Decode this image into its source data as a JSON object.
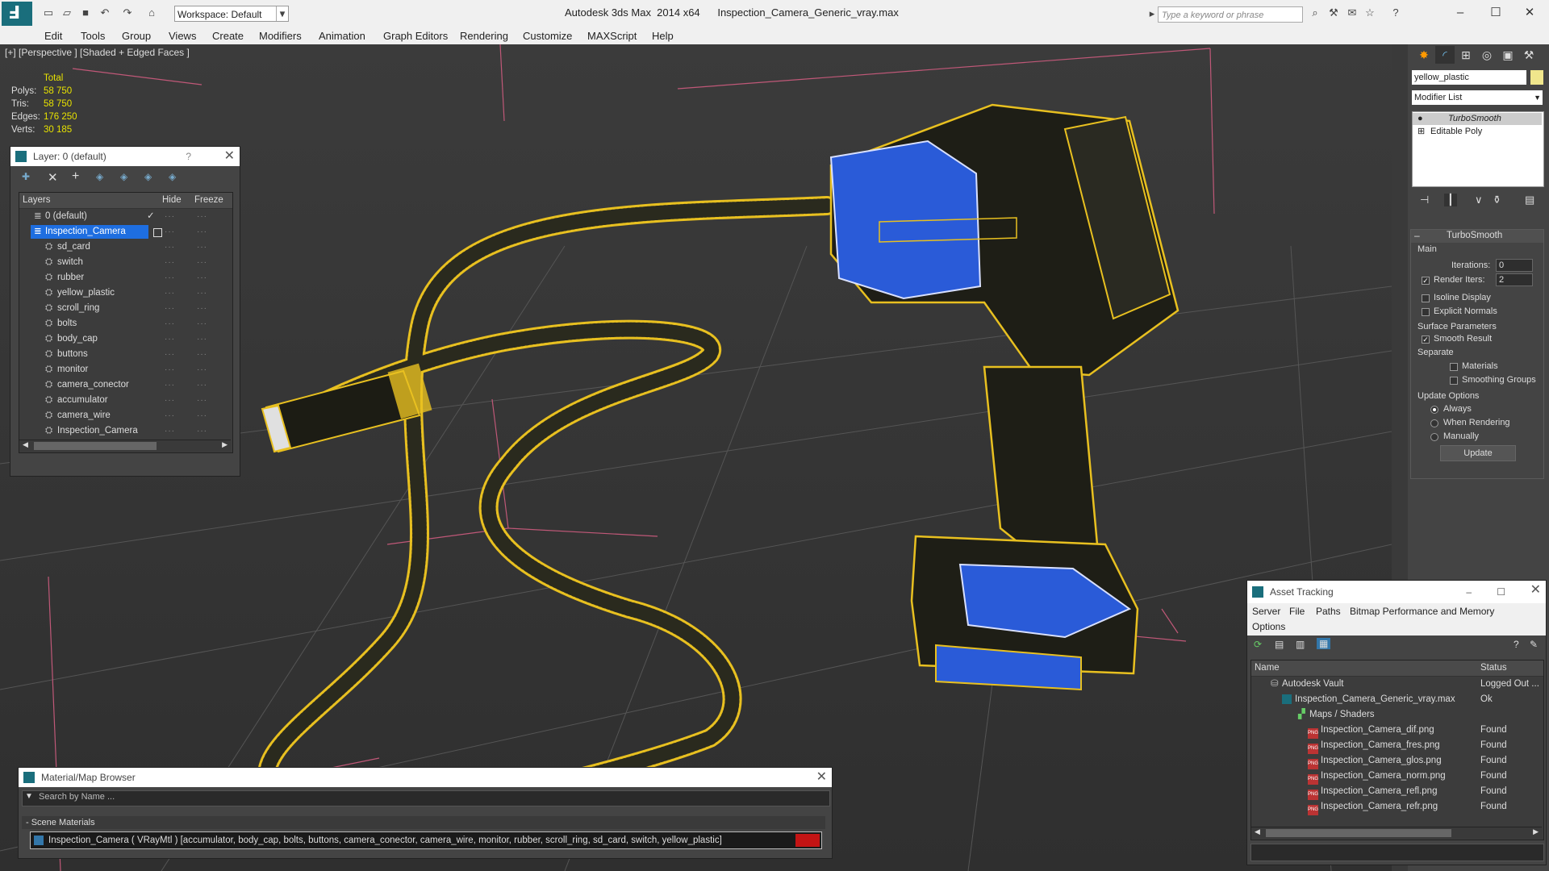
{
  "titlebar": {
    "workspace": "Workspace: Default",
    "app_name": "Autodesk 3ds Max  2014 x64",
    "file_name": "Inspection_Camera_Generic_vray.max",
    "search_placeholder": "Type a keyword or phrase"
  },
  "menu": [
    "Edit",
    "Tools",
    "Group",
    "Views",
    "Create",
    "Modifiers",
    "Animation",
    "Graph Editors",
    "Rendering",
    "Customize",
    "MAXScript",
    "Help"
  ],
  "viewport": {
    "label": "[+] [Perspective ] [Shaded + Edged Faces ]",
    "stats": {
      "header": "Total",
      "rows": [
        {
          "label": "Polys:",
          "value": "58 750"
        },
        {
          "label": "Tris:",
          "value": "58 750"
        },
        {
          "label": "Edges:",
          "value": "176 250"
        },
        {
          "label": "Verts:",
          "value": "30 185"
        }
      ]
    }
  },
  "layer_window": {
    "title": "Layer: 0 (default)",
    "help": "?",
    "columns": {
      "name": "Layers",
      "hide": "Hide",
      "freeze": "Freeze"
    },
    "items": [
      {
        "name": "0 (default)",
        "level": 0,
        "selected": false
      },
      {
        "name": "Inspection_Camera",
        "level": 0,
        "selected": true
      },
      {
        "name": "sd_card",
        "level": 1
      },
      {
        "name": "switch",
        "level": 1
      },
      {
        "name": "rubber",
        "level": 1
      },
      {
        "name": "yellow_plastic",
        "level": 1
      },
      {
        "name": "scroll_ring",
        "level": 1
      },
      {
        "name": "bolts",
        "level": 1
      },
      {
        "name": "body_cap",
        "level": 1
      },
      {
        "name": "buttons",
        "level": 1
      },
      {
        "name": "monitor",
        "level": 1
      },
      {
        "name": "camera_conector",
        "level": 1
      },
      {
        "name": "accumulator",
        "level": 1
      },
      {
        "name": "camera_wire",
        "level": 1
      },
      {
        "name": "Inspection_Camera",
        "level": 1
      }
    ]
  },
  "command_panel": {
    "object_name": "yellow_plastic",
    "object_color": "#f0e68c",
    "modifier_list": "Modifier List",
    "stack": [
      "TurboSmooth",
      "Editable Poly"
    ],
    "rollout_title": "TurboSmooth",
    "main_label": "Main",
    "iterations_label": "Iterations:",
    "iterations_value": "0",
    "render_iters_label": "Render Iters:",
    "render_iters_value": "2",
    "isoline": "Isoline Display",
    "explicit_normals": "Explicit Normals",
    "surface_params": "Surface Parameters",
    "smooth_result": "Smooth Result",
    "separate": "Separate",
    "materials": "Materials",
    "smoothing_groups": "Smoothing Groups",
    "update_options": "Update Options",
    "always": "Always",
    "when_rendering": "When Rendering",
    "manually": "Manually",
    "update_button": "Update"
  },
  "material_browser": {
    "title": "Material/Map Browser",
    "search_placeholder": "Search by Name ...",
    "group": "- Scene Materials",
    "entry": "Inspection_Camera  ( VRayMtl ) [accumulator, body_cap, bolts, buttons, camera_conector, camera_wire, monitor, rubber, scroll_ring, sd_card, switch, yellow_plastic]"
  },
  "asset_tracking": {
    "title": "Asset Tracking",
    "menu": [
      "Server",
      "File",
      "Paths",
      "Bitmap Performance and Memory",
      "Options"
    ],
    "columns": {
      "name": "Name",
      "status": "Status"
    },
    "rows": [
      {
        "name": "Autodesk Vault",
        "status": "Logged Out ...",
        "level": 0
      },
      {
        "name": "Inspection_Camera_Generic_vray.max",
        "status": "Ok",
        "level": 1
      },
      {
        "name": "Maps / Shaders",
        "status": "",
        "level": 2
      },
      {
        "name": "Inspection_Camera_dif.png",
        "status": "Found",
        "level": 3
      },
      {
        "name": "Inspection_Camera_fres.png",
        "status": "Found",
        "level": 3
      },
      {
        "name": "Inspection_Camera_glos.png",
        "status": "Found",
        "level": 3
      },
      {
        "name": "Inspection_Camera_norm.png",
        "status": "Found",
        "level": 3
      },
      {
        "name": "Inspection_Camera_refl.png",
        "status": "Found",
        "level": 3
      },
      {
        "name": "Inspection_Camera_refr.png",
        "status": "Found",
        "level": 3
      }
    ]
  },
  "colors": {
    "wire_yellow": "#e8c020",
    "selection_blue": "#2a5bd8",
    "layer_select": "#1e6ee0",
    "red_grid": "#d06080"
  }
}
